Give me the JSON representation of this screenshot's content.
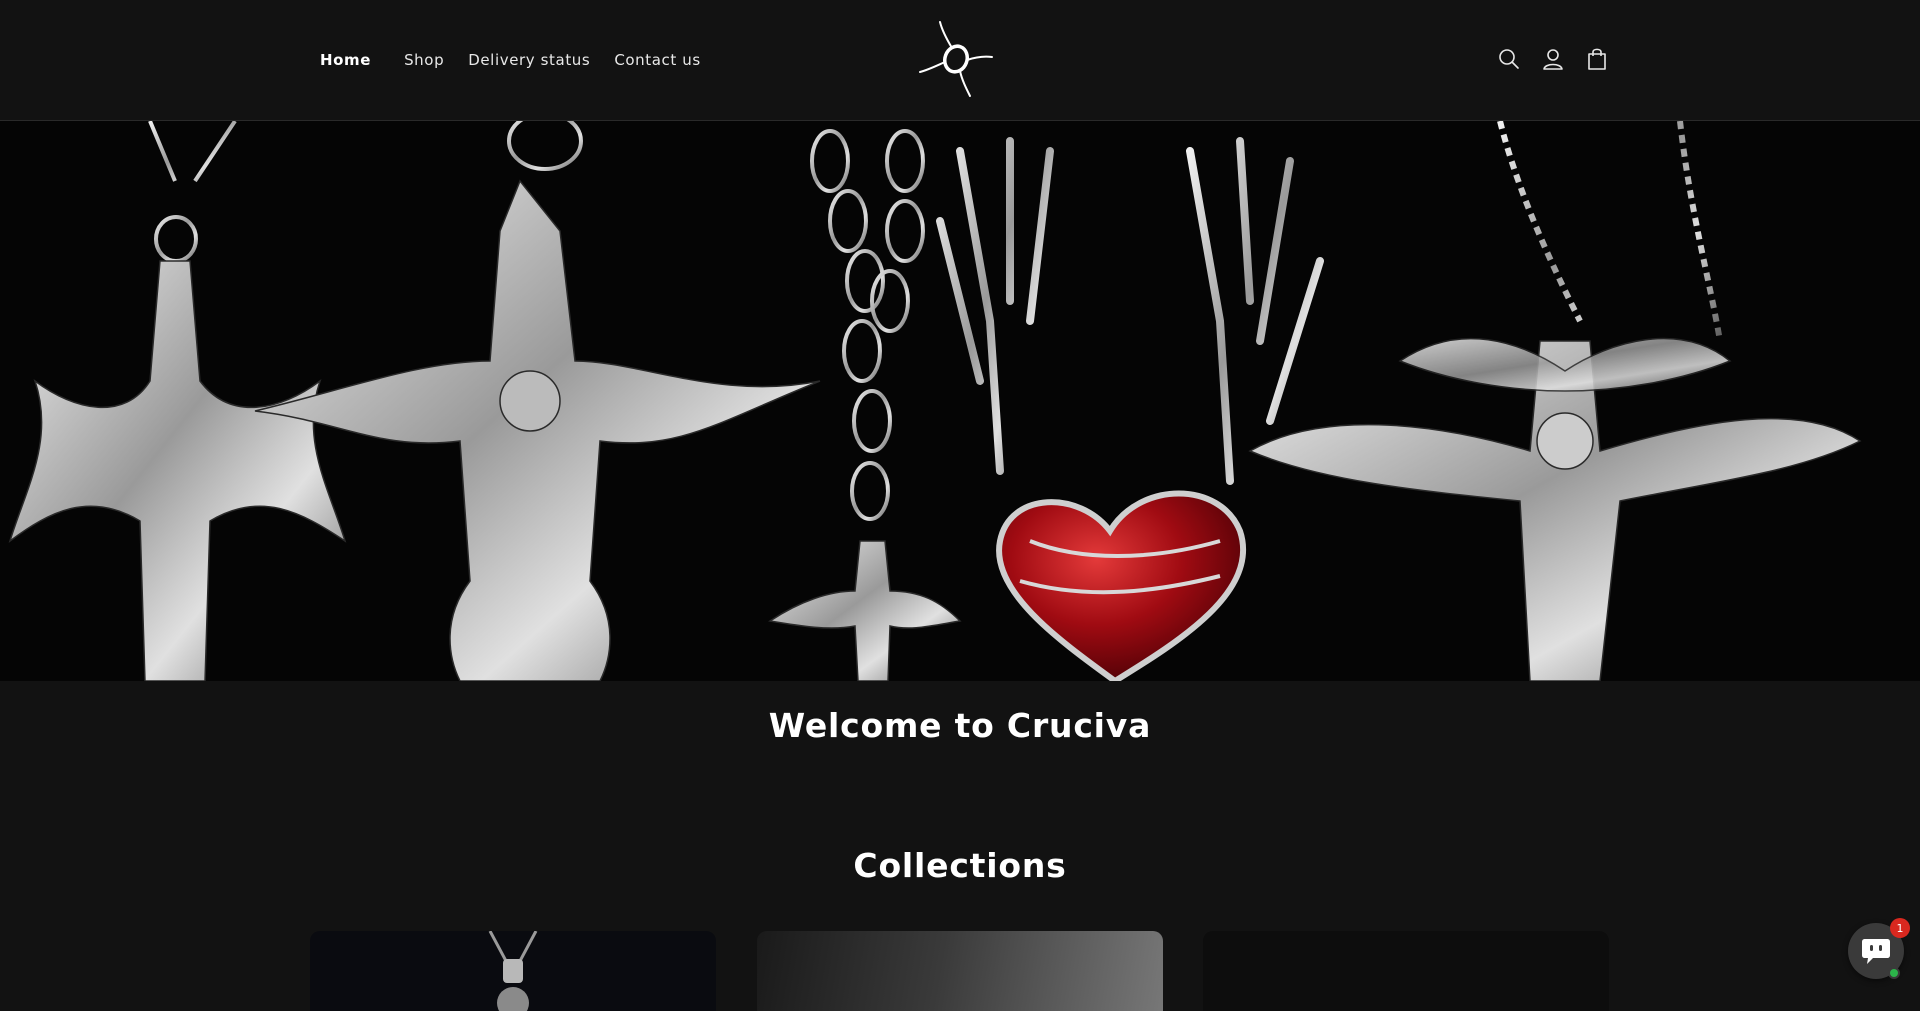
{
  "header": {
    "nav": [
      {
        "label": "Home",
        "active": true
      },
      {
        "label": "Shop",
        "active": false
      },
      {
        "label": "Delivery status",
        "active": false
      },
      {
        "label": "Contact us",
        "active": false
      }
    ],
    "icons": [
      "search-icon",
      "account-icon",
      "cart-icon"
    ]
  },
  "hero": {
    "image": "silver gothic cross and heart necklaces on black background"
  },
  "main": {
    "welcome_title": "Welcome to Cruciva",
    "collections_title": "Collections"
  },
  "chat": {
    "badge_count": "1"
  },
  "colors": {
    "background": "#121212",
    "text": "#ffffff",
    "badge": "#d9281f",
    "online": "#2cb34a"
  }
}
